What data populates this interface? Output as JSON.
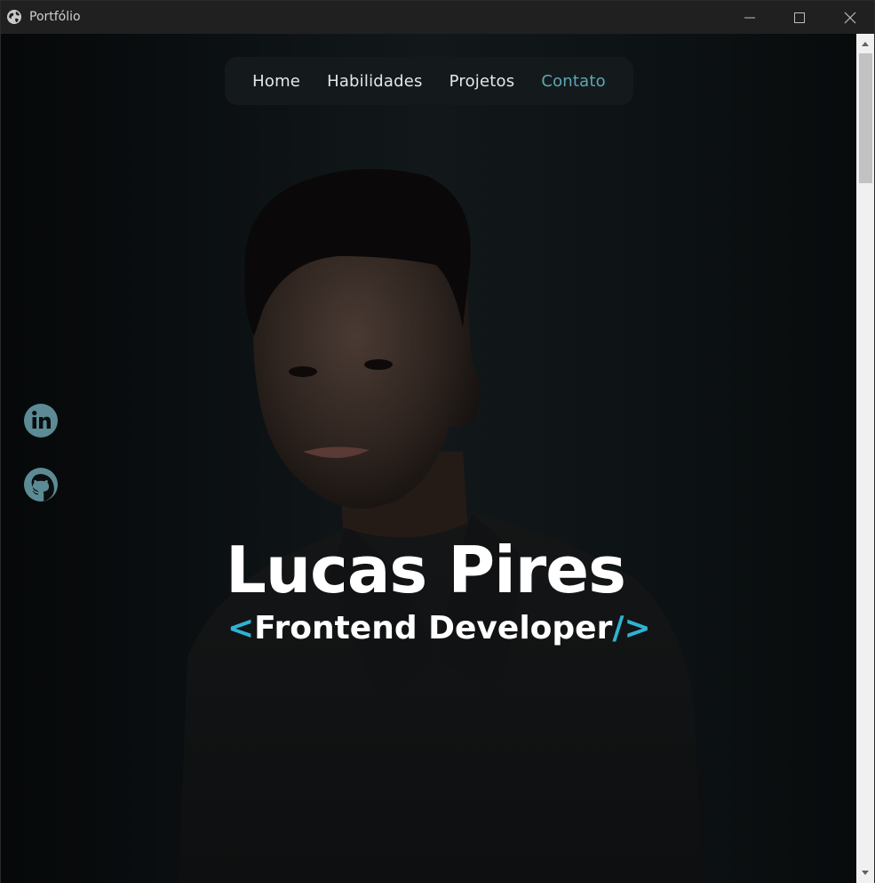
{
  "window": {
    "title": "Portfólio",
    "app_icon": "globe-icon",
    "controls": [
      "minimize-icon",
      "maximize-icon",
      "close-icon"
    ]
  },
  "nav": {
    "items": [
      {
        "label": "Home"
      },
      {
        "label": "Habilidades"
      },
      {
        "label": "Projetos"
      },
      {
        "label": "Contato"
      }
    ],
    "active": "Contato"
  },
  "social": [
    {
      "icon": "linkedin-icon"
    },
    {
      "icon": "github-icon"
    }
  ],
  "hero": {
    "name": "Lucas Pires",
    "role_open": "<",
    "role": "Frontend Developer",
    "role_close": "/>"
  },
  "colors": {
    "accent": "#2fb3d2",
    "nav_active": "#5fa7b3",
    "social_icon": "#5c8b96",
    "background": "#0b0d0e"
  }
}
